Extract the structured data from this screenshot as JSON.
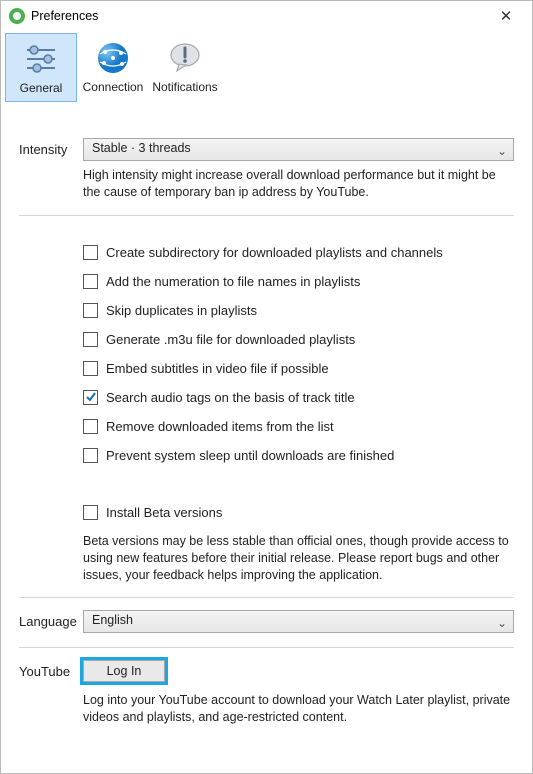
{
  "window": {
    "title": "Preferences"
  },
  "tabs": [
    {
      "label": "General"
    },
    {
      "label": "Connection"
    },
    {
      "label": "Notifications"
    }
  ],
  "intensity": {
    "label": "Intensity",
    "value": "Stable · 3 threads",
    "hint": "High intensity might increase overall download performance but it might be the cause of temporary ban ip address by YouTube."
  },
  "options": [
    {
      "label": "Create subdirectory for downloaded playlists and channels",
      "checked": false
    },
    {
      "label": "Add the numeration to file names in playlists",
      "checked": false
    },
    {
      "label": "Skip duplicates in playlists",
      "checked": false
    },
    {
      "label": "Generate .m3u file for downloaded playlists",
      "checked": false
    },
    {
      "label": "Embed subtitles in video file if possible",
      "checked": false
    },
    {
      "label": "Search audio tags on the basis of track title",
      "checked": true
    },
    {
      "label": "Remove downloaded items from the list",
      "checked": false
    },
    {
      "label": "Prevent system sleep until downloads are finished",
      "checked": false
    }
  ],
  "beta": {
    "label": "Install Beta versions",
    "checked": false,
    "hint": "Beta versions may be less stable than official ones, though provide access to using new features before their initial release. Please report bugs and other issues, your feedback helps improving the application."
  },
  "language": {
    "label": "Language",
    "value": "English"
  },
  "youtube": {
    "label": "YouTube",
    "button": "Log In",
    "hint": "Log into your YouTube account to download your Watch Later playlist, private videos and playlists, and age-restricted content."
  }
}
